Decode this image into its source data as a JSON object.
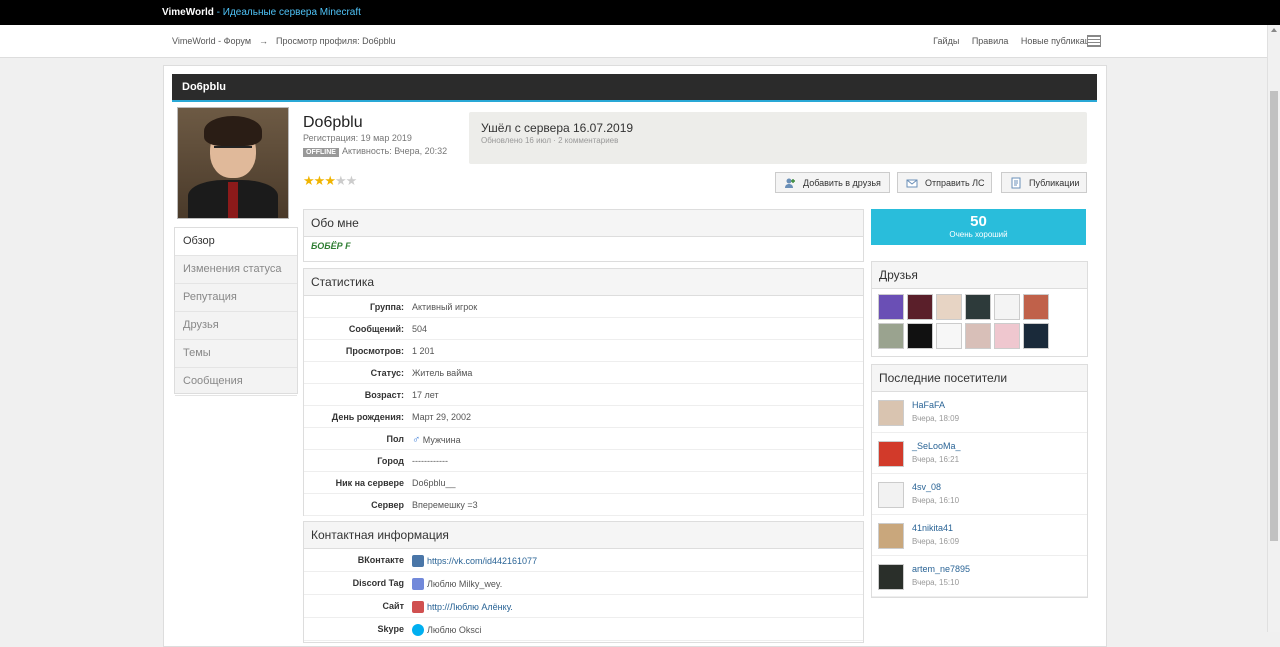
{
  "topbar": {
    "brand": "VimeWorld",
    "separator": " - ",
    "tagline": "Идеальные сервера Minecraft"
  },
  "breadcrumb": {
    "home": "VimeWorld - Форум",
    "arrow": "→",
    "current": "Просмотр профиля: Do6pblu"
  },
  "nav": {
    "guides": "Гайды",
    "rules": "Правила",
    "new_posts": "Новые публикации"
  },
  "profile": {
    "header_title": "Do6pblu",
    "name": "Do6pblu",
    "registration": "Регистрация: 19 мар 2019",
    "offline_badge": "OFFLINE",
    "activity": "Активность: Вчера, 20:32",
    "rating_stars": 3,
    "rating_max": 5,
    "status_text": "Ушёл с сервера 16.07.2019",
    "status_meta": "Обновлено 16 июл · 2 комментариев"
  },
  "actions": {
    "add_friend": "Добавить в друзья",
    "send_pm": "Отправить ЛС",
    "posts": "Публикации"
  },
  "sidebar": {
    "items": [
      {
        "label": "Обзор",
        "active": true
      },
      {
        "label": "Изменения статуса",
        "active": false
      },
      {
        "label": "Репутация",
        "active": false
      },
      {
        "label": "Друзья",
        "active": false
      },
      {
        "label": "Темы",
        "active": false
      },
      {
        "label": "Сообщения",
        "active": false
      }
    ]
  },
  "about": {
    "title": "Обо мне",
    "text": "БОБЁР F"
  },
  "stats": {
    "title": "Статистика",
    "rows": [
      {
        "key": "Группа:",
        "value": "Активный игрок"
      },
      {
        "key": "Сообщений:",
        "value": "504"
      },
      {
        "key": "Просмотров:",
        "value": "1 201"
      },
      {
        "key": "Статус:",
        "value": "Житель вайма"
      },
      {
        "key": "Возраст:",
        "value": "17 лет"
      },
      {
        "key": "День рождения:",
        "value": "Март 29, 2002"
      },
      {
        "key": "Пол",
        "value": "Мужчина"
      },
      {
        "key": "Город",
        "value": "------------"
      },
      {
        "key": "Ник на сервере",
        "value": "Do6pblu__"
      },
      {
        "key": "Сервер",
        "value": "Вперемешку =3"
      }
    ]
  },
  "contact": {
    "title": "Контактная информация",
    "rows": [
      {
        "key": "ВКонтакте",
        "value": "https://vk.com/id442161077",
        "icon": "vk-icon",
        "color": "#4a76a8"
      },
      {
        "key": "Discord Tag",
        "value": "Люблю Milky_wey.",
        "icon": "discord-icon",
        "color": "#7289da"
      },
      {
        "key": "Сайт",
        "value": "http://Люблю Алёнку.",
        "icon": "website-icon",
        "color": "#d05050"
      },
      {
        "key": "Skype",
        "value": "Люблю Oksci",
        "icon": "skype-icon",
        "color": "#00aff0"
      }
    ]
  },
  "reputation": {
    "value": "50",
    "label": "Очень хороший"
  },
  "friends": {
    "title": "Друзья",
    "colors": [
      "#6a4fb5",
      "#5a1f2a",
      "#e7d4c4",
      "#2d3a3a",
      "#f4f4f4",
      "#c0614a",
      "#9aa38f",
      "#111111",
      "#f7f7f7",
      "#d8bfb8",
      "#efc7cf",
      "#1a2a3a"
    ]
  },
  "visitors": {
    "title": "Последние посетители",
    "items": [
      {
        "name": "HaFaFA",
        "time": "Вчера, 18:09",
        "color": "#d9c4b0"
      },
      {
        "name": "_SeLooMa_",
        "time": "Вчера, 16:21",
        "color": "#d23a2a"
      },
      {
        "name": "4sv_08",
        "time": "Вчера, 16:10",
        "color": "#f2f2f2"
      },
      {
        "name": "41nikita41",
        "time": "Вчера, 16:09",
        "color": "#c9a77c"
      },
      {
        "name": "artem_ne7895",
        "time": "Вчера, 15:10",
        "color": "#2a2f2a"
      }
    ]
  },
  "colors": {
    "accent": "#29a8d6",
    "reputation_bg": "#29bddb",
    "link": "#2a6496"
  }
}
